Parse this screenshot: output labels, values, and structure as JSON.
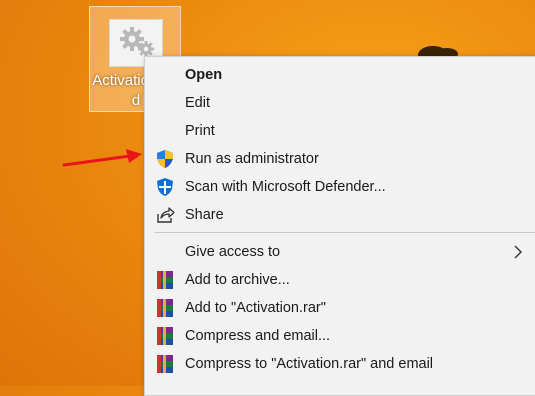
{
  "desktop": {
    "icon_label": "Activation.rar\nd",
    "background_color": "#ec8a10",
    "arrow_color": "#e8151b"
  },
  "menu": {
    "items": [
      {
        "label": "Open",
        "bold": true,
        "icon": ""
      },
      {
        "label": "Edit",
        "icon": ""
      },
      {
        "label": "Print",
        "icon": ""
      },
      {
        "label": "Run as administrator",
        "icon": "uac-shield-icon"
      },
      {
        "label": "Scan with Microsoft Defender...",
        "icon": "defender-icon"
      },
      {
        "label": "Share",
        "icon": "share-icon"
      },
      {
        "label": "Give access to",
        "icon": "",
        "has_submenu": true
      },
      {
        "label": "Add to archive...",
        "icon": "winrar-icon"
      },
      {
        "label": "Add to \"Activation.rar\"",
        "icon": "winrar-icon"
      },
      {
        "label": "Compress and email...",
        "icon": "winrar-icon"
      },
      {
        "label": "Compress to \"Activation.rar\" and email",
        "icon": "winrar-icon"
      }
    ]
  }
}
